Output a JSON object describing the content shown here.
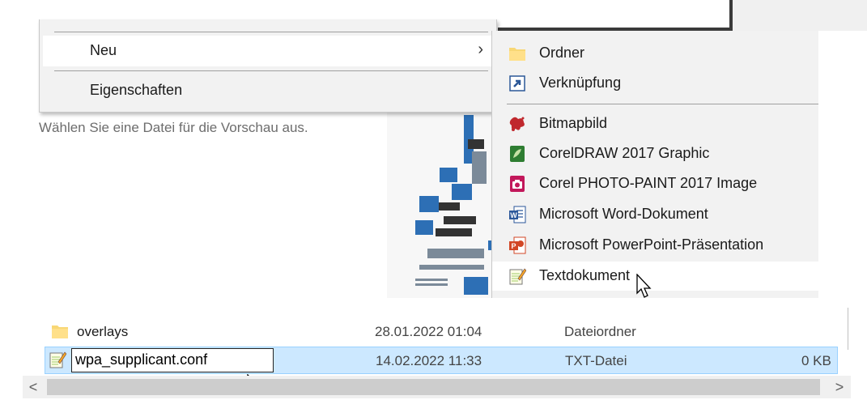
{
  "context_menu": {
    "items": [
      {
        "label": "Neu",
        "has_submenu": true,
        "arrow": "›"
      },
      {
        "label": "Eigenschaften"
      }
    ]
  },
  "submenu_new": {
    "items": [
      {
        "label": "Ordner",
        "icon": "folder-icon"
      },
      {
        "label": "Verknüpfung",
        "icon": "shortcut-icon"
      },
      {
        "label": "Bitmapbild",
        "icon": "bitmap-icon"
      },
      {
        "label": "CorelDRAW 2017 Graphic",
        "icon": "coreldraw-icon"
      },
      {
        "label": "Corel PHOTO-PAINT 2017 Image",
        "icon": "photopaint-icon"
      },
      {
        "label": "Microsoft Word-Dokument",
        "icon": "word-icon"
      },
      {
        "label": "Microsoft PowerPoint-Präsentation",
        "icon": "powerpoint-icon"
      },
      {
        "label": "Textdokument",
        "icon": "text-document-icon"
      }
    ]
  },
  "preview_pane": {
    "message": "Wählen Sie eine Datei für die Vorschau aus."
  },
  "file_list": {
    "rows": [
      {
        "name": "overlays",
        "date": "28.01.2022 01:04",
        "type": "Dateiordner",
        "size": "",
        "icon": "folder-icon"
      },
      {
        "name": "wpa_supplicant.conf",
        "date": "14.02.2022 11:33",
        "type": "TXT-Datei",
        "size": "0 KB",
        "icon": "text-file-icon",
        "renaming": true
      }
    ]
  },
  "scrollbar": {
    "left_arrow": "<",
    "right_arrow": ">"
  },
  "colors": {
    "menu_bg": "#f2f2f2",
    "menu_hover": "#ffffff",
    "selection_bg": "#cce8ff",
    "selection_border": "#99d1ff"
  }
}
